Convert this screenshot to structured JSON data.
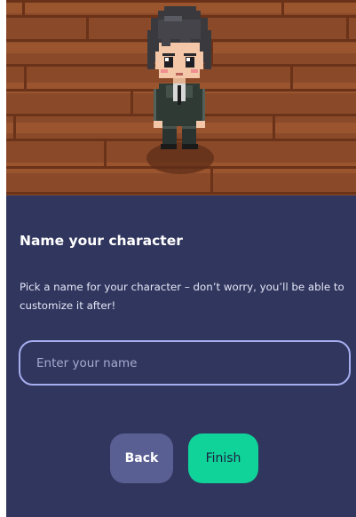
{
  "character_preview": {
    "floor_color": "#8a4a2a",
    "plank_line_color": "#6a3218"
  },
  "dialog": {
    "title": "Name your character",
    "description": "Pick a name for your character – don’t worry, you’ll be able to customize it after!",
    "name_input": {
      "value": "",
      "placeholder": "Enter your name"
    },
    "back_label": "Back",
    "finish_label": "Finish"
  },
  "colors": {
    "panel_bg": "#31365e",
    "input_border": "#a6aef0",
    "back_button": "#5a5f93",
    "finish_button": "#10d39a"
  }
}
